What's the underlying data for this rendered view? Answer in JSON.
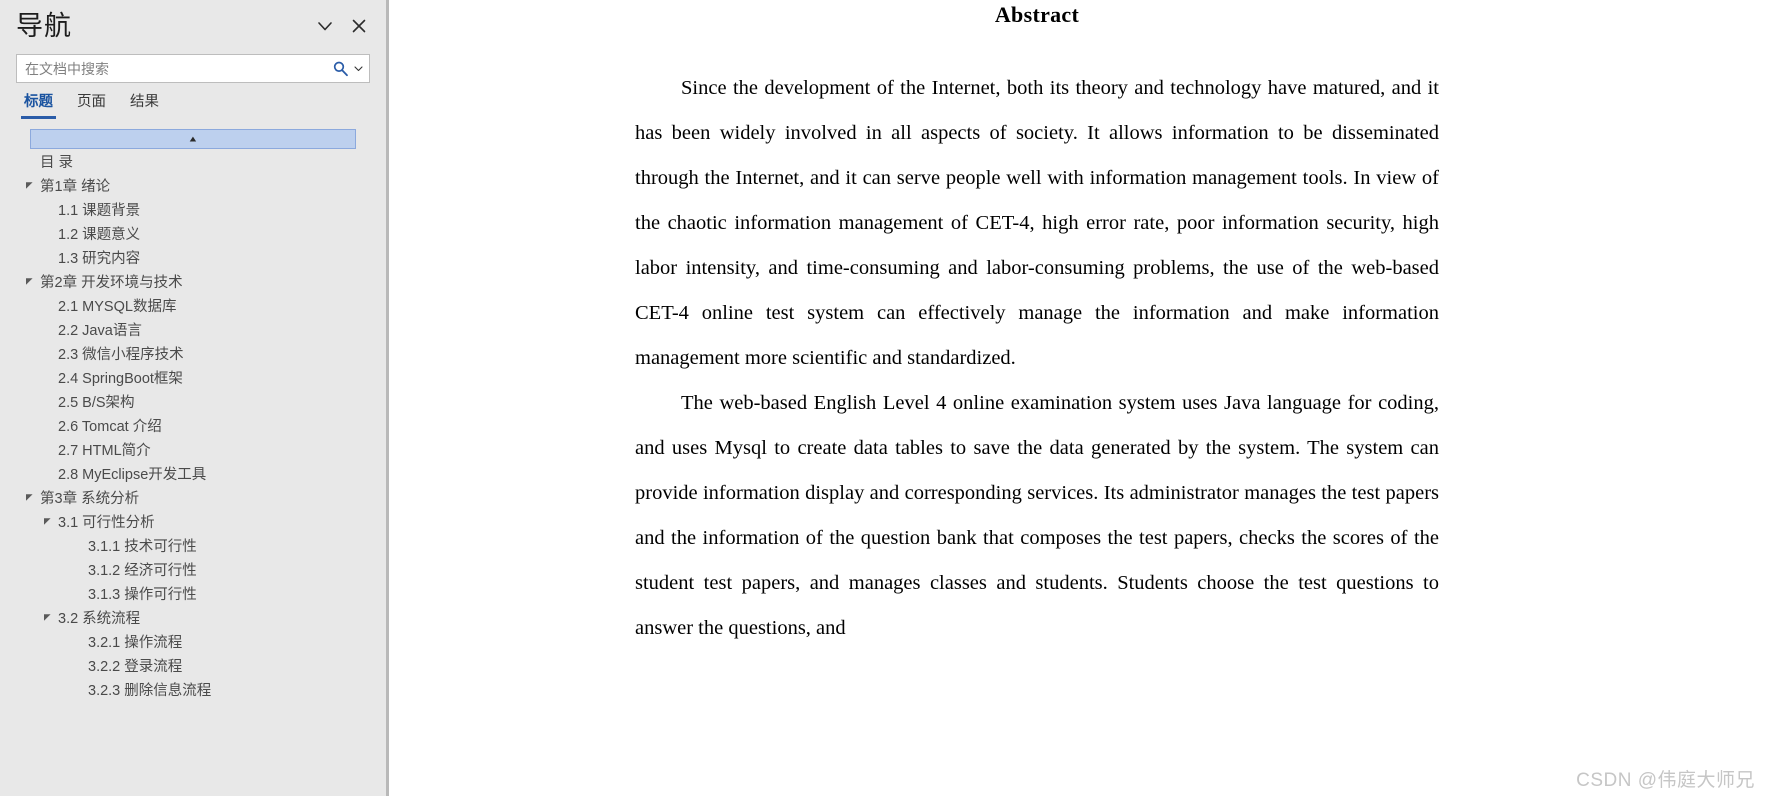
{
  "nav": {
    "title": "导航",
    "collapse_icon": "chevron-down-icon",
    "close_icon": "close-icon",
    "search": {
      "placeholder": "在文档中搜索",
      "value": "",
      "icon": "search-icon",
      "dropdown_icon": "chevron-down-icon"
    },
    "tabs": [
      {
        "label": "标题",
        "active": true
      },
      {
        "label": "页面",
        "active": false
      },
      {
        "label": "结果",
        "active": false
      }
    ],
    "tree": [
      {
        "label": "",
        "level": 0,
        "selected": true,
        "expandable": false,
        "glyph": "▲"
      },
      {
        "label": "目 录",
        "level": 0,
        "selected": false,
        "expandable": false
      },
      {
        "label": "第1章 绪论",
        "level": 1,
        "selected": false,
        "expandable": true
      },
      {
        "label": "1.1 课题背景",
        "level": 2,
        "selected": false,
        "expandable": false
      },
      {
        "label": "1.2 课题意义",
        "level": 2,
        "selected": false,
        "expandable": false
      },
      {
        "label": "1.3 研究内容",
        "level": 2,
        "selected": false,
        "expandable": false
      },
      {
        "label": "第2章 开发环境与技术",
        "level": 1,
        "selected": false,
        "expandable": true
      },
      {
        "label": "2.1 MYSQL数据库",
        "level": 2,
        "selected": false,
        "expandable": false
      },
      {
        "label": "2.2 Java语言",
        "level": 2,
        "selected": false,
        "expandable": false
      },
      {
        "label": "2.3 微信小程序技术",
        "level": 2,
        "selected": false,
        "expandable": false
      },
      {
        "label": "2.4 SpringBoot框架",
        "level": 2,
        "selected": false,
        "expandable": false
      },
      {
        "label": "2.5 B/S架构",
        "level": 2,
        "selected": false,
        "expandable": false
      },
      {
        "label": "2.6 Tomcat 介绍",
        "level": 2,
        "selected": false,
        "expandable": false
      },
      {
        "label": "2.7 HTML简介",
        "level": 2,
        "selected": false,
        "expandable": false
      },
      {
        "label": "2.8 MyEclipse开发工具",
        "level": 2,
        "selected": false,
        "expandable": false
      },
      {
        "label": "第3章 系统分析",
        "level": 1,
        "selected": false,
        "expandable": true
      },
      {
        "label": "3.1 可行性分析",
        "level": 2,
        "selected": false,
        "expandable": true
      },
      {
        "label": "3.1.1 技术可行性",
        "level": 3,
        "selected": false,
        "expandable": false
      },
      {
        "label": "3.1.2 经济可行性",
        "level": 3,
        "selected": false,
        "expandable": false
      },
      {
        "label": "3.1.3 操作可行性",
        "level": 3,
        "selected": false,
        "expandable": false
      },
      {
        "label": "3.2 系统流程",
        "level": 2,
        "selected": false,
        "expandable": true
      },
      {
        "label": "3.2.1 操作流程",
        "level": 3,
        "selected": false,
        "expandable": false
      },
      {
        "label": "3.2.2 登录流程",
        "level": 3,
        "selected": false,
        "expandable": false
      },
      {
        "label": "3.2.3 删除信息流程",
        "level": 3,
        "selected": false,
        "expandable": false
      }
    ]
  },
  "document": {
    "heading": "Abstract",
    "paragraph1": "Since the development of the Internet, both its theory and technology have matured, and it has been widely involved in all aspects of society. It allows information to be disseminated through the Internet, and it can serve people well with information management tools. In view of the chaotic information management of CET-4, high error rate, poor information security, high labor intensity, and time-consuming and labor-consuming problems, the use of the web-based CET-4 online test system can effectively manage the information and make information management more scientific and standardized.",
    "paragraph2": "The web-based English Level 4 online examination system uses Java language for coding, and uses Mysql to create data tables to save the data generated by the system. The system can provide information display and corresponding services. Its administrator manages the test papers and the information of the question bank that composes the test papers, checks the scores of the student test papers, and manages classes and students. Students choose the test questions to answer the questions, and"
  },
  "watermark": {
    "text": "CSDN @伟庭大师兄"
  },
  "colors": {
    "pane_background": "#e8e8e8",
    "accent_blue": "#2a5ca8",
    "selection_fill": "#bdd0ee",
    "selection_border": "#8ca9dd",
    "tree_text": "#4a4a4a",
    "watermark": "#c6c6c6"
  }
}
